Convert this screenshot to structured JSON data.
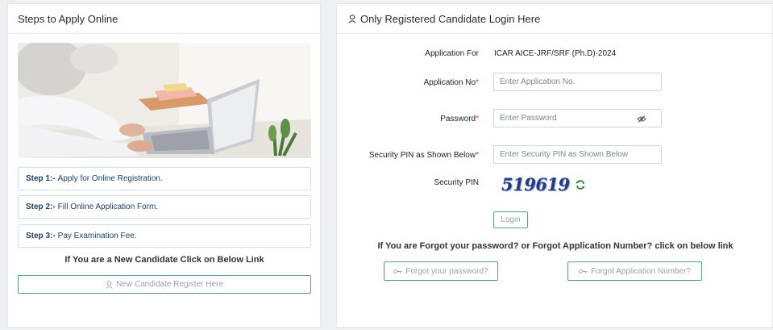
{
  "left": {
    "title": "Steps to Apply Online",
    "steps": [
      {
        "label": "Step 1:-",
        "text": "Apply for Online Registration."
      },
      {
        "label": "Step 2:-",
        "text": "Fill Online Application Form."
      },
      {
        "label": "Step 3:-",
        "text": "Pay Examination Fee."
      }
    ],
    "new_candidate_text": "If You are a New Candidate Click on Below Link",
    "register_button": "New Candidate Register Here"
  },
  "right": {
    "title": "Only Registered Candidate Login Here",
    "application_for_label": "Application For",
    "application_for_value": "ICAR AICE-JRF/SRF (Ph.D)-2024",
    "application_no_label": "Application No",
    "application_no_placeholder": "Enter Application No.",
    "password_label": "Password",
    "password_placeholder": "Enter Password",
    "security_pin_input_label": "Security PIN as Shown Below",
    "security_pin_placeholder": "Enter Security PIN as Shown Below",
    "security_pin_label": "Security PIN",
    "captcha": "519619",
    "login_button": "Login",
    "forgot_text": "If You are Forgot your password? or Forgot Application Number? click on below link",
    "forgot_password_button": "Forgot your password?",
    "forgot_appno_button": "Forgot Application Number?",
    "required_marker": "*"
  },
  "colors": {
    "accent_border": "#5a9e8c",
    "required": "#d6343c",
    "captcha": "#243b8a",
    "refresh": "#2e8b3a"
  }
}
